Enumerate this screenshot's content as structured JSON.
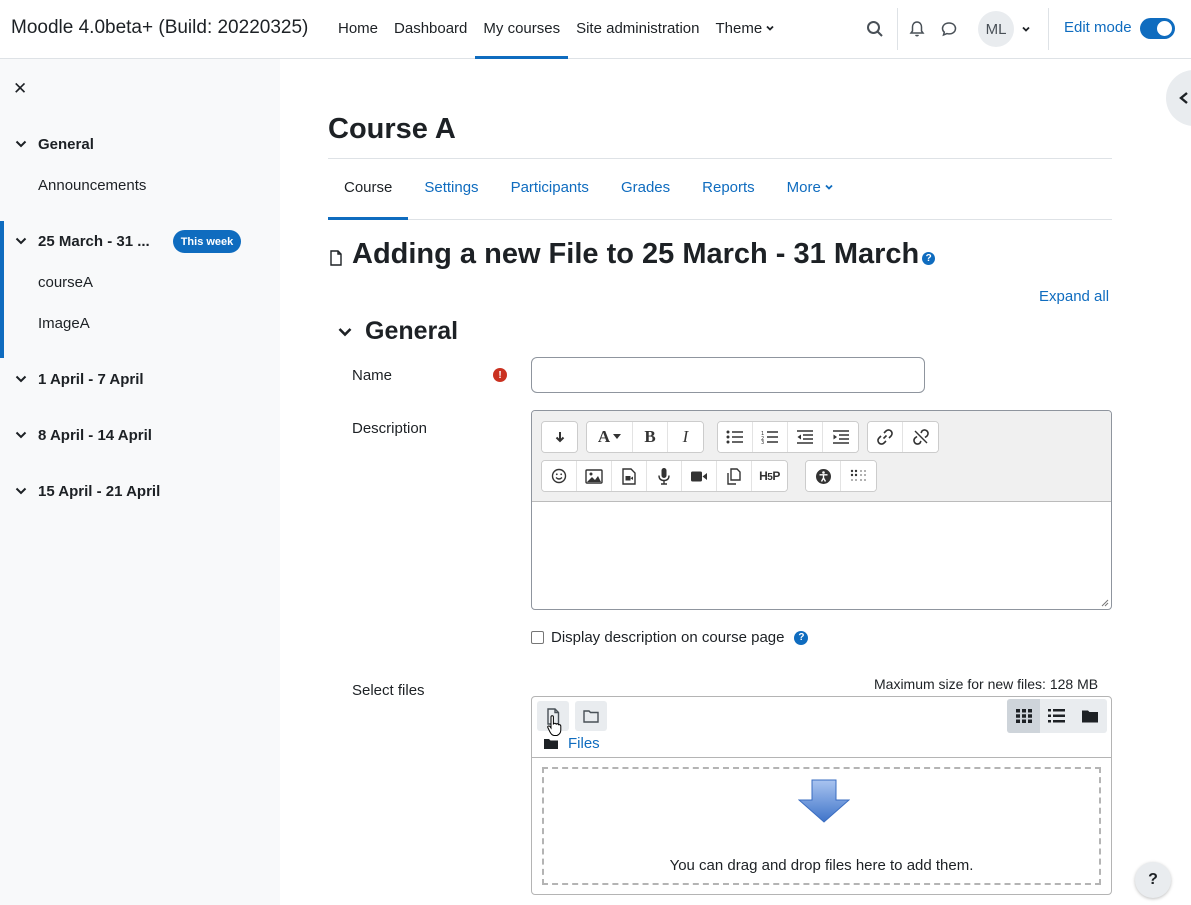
{
  "navbar": {
    "brand": "Moodle 4.0beta+ (Build: 20220325)",
    "items": [
      {
        "label": "Home",
        "active": false
      },
      {
        "label": "Dashboard",
        "active": false
      },
      {
        "label": "My courses",
        "active": true
      },
      {
        "label": "Site administration",
        "active": false
      }
    ],
    "theme_label": "Theme",
    "user_initials": "ML",
    "edit_mode_label": "Edit mode",
    "edit_mode_on": true
  },
  "sidebar": {
    "sections": [
      {
        "title": "General",
        "items": [
          "Announcements"
        ]
      },
      {
        "title": "25 March - 31 ...",
        "badge": "This week",
        "items": [
          "courseA",
          "ImageA"
        ]
      },
      {
        "title": "1 April - 7 April",
        "items": []
      },
      {
        "title": "8 April - 14 April",
        "items": []
      },
      {
        "title": "15 April - 21 April",
        "items": []
      }
    ]
  },
  "course": {
    "title": "Course A",
    "tabs": [
      "Course",
      "Settings",
      "Participants",
      "Grades",
      "Reports",
      "More"
    ]
  },
  "form": {
    "heading": "Adding a new File to 25 March - 31 March",
    "expand_all": "Expand all",
    "section": "General",
    "name_label": "Name",
    "name_value": "",
    "description_label": "Description",
    "display_description_label": "Display description on course page",
    "select_files_label": "Select files",
    "max_size": "Maximum size for new files: 128 MB",
    "files_path": "Files",
    "drop_text": "You can drag and drop files here to add them."
  },
  "colors": {
    "accent": "#0f6cbf",
    "required": "#ca3120"
  }
}
